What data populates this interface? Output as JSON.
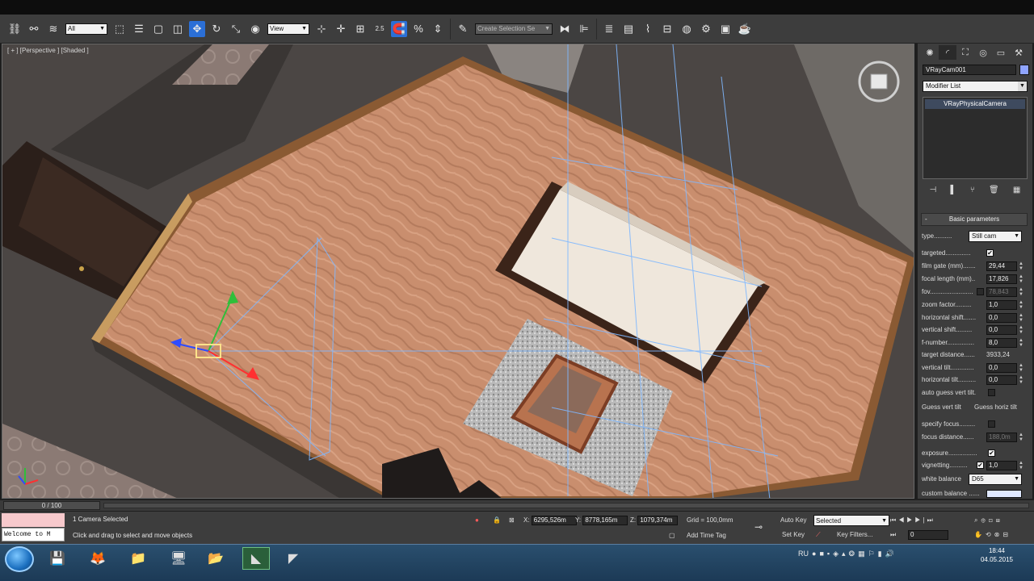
{
  "viewport": {
    "label": "[ + ] [Perspective ] [Shaded ]"
  },
  "toolbar": {
    "selection_filter": "All",
    "reference_coord": "View",
    "angle_snap": "2.5",
    "percent_snap": "%",
    "named_selection": "Create Selection Se"
  },
  "command_panel": {
    "object_name": "VRayCam001",
    "object_color": "#8fa4ff",
    "modifier_list": "Modifier List",
    "stack_item": "VRayPhysicalCamera",
    "rollout_title": "Basic parameters",
    "params": {
      "type_label": "type..........",
      "type_value": "Still cam",
      "targeted_label": "targeted..............",
      "film_gate_label": "film gate (mm).......",
      "film_gate_value": "29,44",
      "focal_length_label": "focal length (mm)..",
      "focal_length_value": "17,826",
      "fov_label": "fov........................",
      "fov_value": "78,843",
      "zoom_label": "zoom factor.........",
      "zoom_value": "1,0",
      "hshift_label": "horizontal shift.......",
      "hshift_value": "0,0",
      "vshift_label": "vertical shift.........",
      "vshift_value": "0,0",
      "fnumber_label": "f-number...............",
      "fnumber_value": "8,0",
      "target_distance_label": "target distance......",
      "target_distance_value": "3933,24",
      "vtilt_label": "vertical tilt.............",
      "vtilt_value": "0,0",
      "htilt_label": "horizontal tilt..........",
      "htilt_value": "0,0",
      "auto_guess_label": "auto guess vert tilt.",
      "guess_vert": "Guess vert tilt",
      "guess_horiz": "Guess horiz tilt",
      "specify_focus_label": "specify focus.........",
      "focus_distance_label": "focus distance......",
      "focus_distance_value": "188,0m",
      "exposure_label": "exposure................",
      "vignetting_label": "vignetting..........",
      "vignetting_value": "1,0",
      "white_balance_label": "white balance",
      "white_balance_value": "D65",
      "custom_balance_label": "custom balance ......",
      "custom_balance_color": "#dfe8ff"
    }
  },
  "timeline": {
    "frame": "0 / 100"
  },
  "status": {
    "maxscript_text": "Welcome to M",
    "selection": "1 Camera Selected",
    "prompt": "Click and drag to select and move objects",
    "x_label": "X:",
    "x_value": "6295,526m",
    "y_label": "Y:",
    "y_value": "8778,165m",
    "z_label": "Z:",
    "z_value": "1079,374m",
    "grid": "Grid = 100,0mm",
    "add_time_tag": "Add Time Tag",
    "auto_key": "Auto Key",
    "set_key": "Set Key",
    "key_mode": "Selected",
    "key_filters": "Key Filters...",
    "current_frame": "0"
  },
  "taskbar": {
    "lang": "RU",
    "time": "18:44",
    "date": "04.05.2015"
  }
}
